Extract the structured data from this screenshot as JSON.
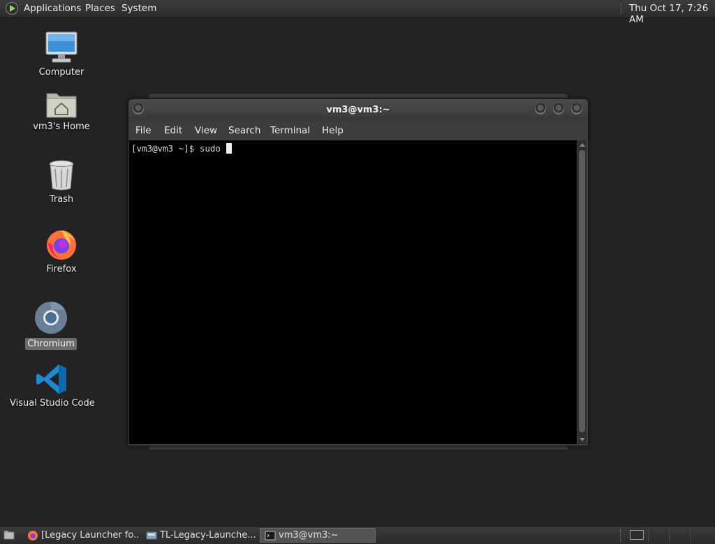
{
  "top_panel": {
    "menus": [
      "Applications",
      "Places",
      "System"
    ],
    "clock": "Thu Oct 17,  7:26 AM"
  },
  "desktop_icons": [
    {
      "label": "Computer",
      "icon": "computer-icon"
    },
    {
      "label": "vm3's Home",
      "icon": "home-folder-icon"
    },
    {
      "label": "Trash",
      "icon": "trash-icon"
    },
    {
      "label": "Firefox",
      "icon": "firefox-icon"
    },
    {
      "label": "Chromium",
      "icon": "chromium-icon"
    },
    {
      "label": "Visual Studio Code",
      "icon": "vscode-icon"
    }
  ],
  "terminal": {
    "title": "vm3@vm3:~",
    "menus": [
      "File",
      "Edit",
      "View",
      "Search",
      "Terminal",
      "Help"
    ],
    "prompt": "[vm3@vm3 ~]$ sudo"
  },
  "taskbar": {
    "tasks": [
      {
        "label": "[Legacy Launcher fo...",
        "icon": "firefox-icon"
      },
      {
        "label": "TL-Legacy-Launche...",
        "icon": "installer-icon"
      },
      {
        "label": "vm3@vm3:~",
        "icon": "terminal-icon",
        "active": true
      }
    ]
  },
  "colors": {
    "desktop_bg": "#232323",
    "terminal_bg": "#000000",
    "panel_bg": "#2f2f2f"
  }
}
